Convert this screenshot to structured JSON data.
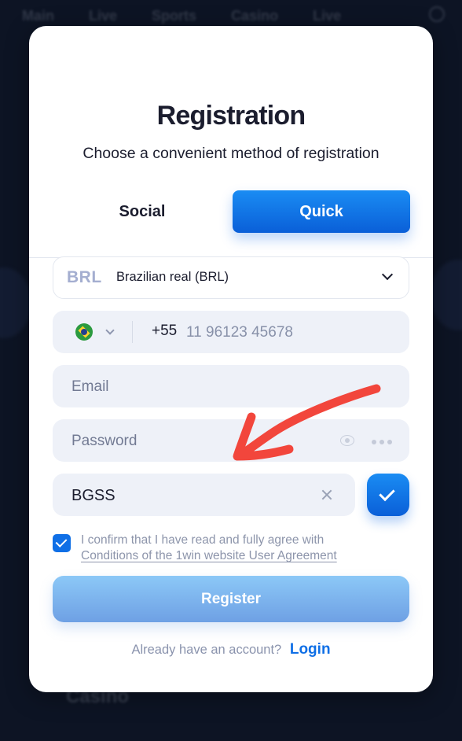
{
  "background": {
    "nav": [
      "Main",
      "Live",
      "Sports",
      "Casino",
      "Live"
    ],
    "section": "Casino"
  },
  "modal": {
    "title": "Registration",
    "subtitle": "Choose a convenient method of registration",
    "tabs": {
      "social": "Social",
      "quick": "Quick",
      "active": "Quick"
    },
    "currency": {
      "code": "BRL",
      "name": "Brazilian real (BRL)"
    },
    "phone": {
      "country_code": "+55",
      "placeholder": "11 96123 45678"
    },
    "email": {
      "placeholder": "Email"
    },
    "password": {
      "placeholder": "Password"
    },
    "promo": {
      "value": "BGSS"
    },
    "agreement": {
      "checked": true,
      "text": "I confirm that I have read and fully agree with",
      "link": "Conditions of the 1win website User Agreement"
    },
    "register_label": "Register",
    "footer": {
      "question": "Already have an account?",
      "login": "Login"
    }
  },
  "annotation": {
    "color": "#f2463c",
    "icon": "red-arrow"
  },
  "colors": {
    "accent": "#0f6fe6",
    "register_button": "#7fb4ee",
    "field_bg": "#eef1f8"
  }
}
